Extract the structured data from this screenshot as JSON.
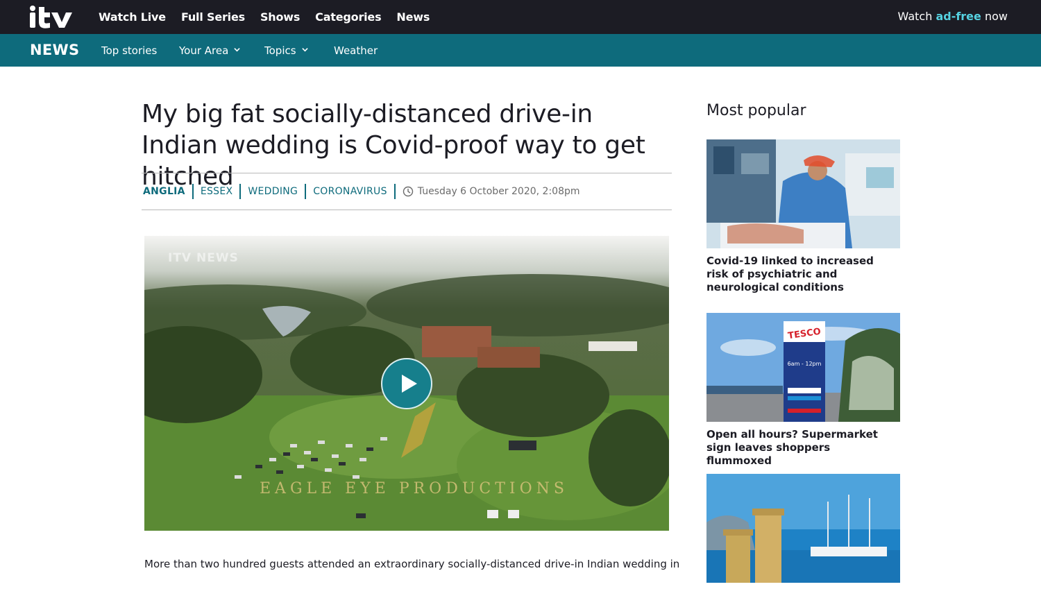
{
  "topbar": {
    "brand": "itv",
    "nav": [
      "Watch Live",
      "Full Series",
      "Shows",
      "Categories",
      "News"
    ],
    "watch_prefix": "Watch ",
    "watch_accent": "ad-free",
    "watch_suffix": " now"
  },
  "newsbar": {
    "brand": "NEWS",
    "top_stories": "Top stories",
    "your_area": "Your Area",
    "topics": "Topics",
    "weather": "Weather"
  },
  "article": {
    "headline": "My big fat socially-distanced drive-in Indian wedding is Covid-proof way to get hitched",
    "tags": [
      "ANGLIA",
      "ESSEX",
      "WEDDING",
      "CORONAVIRUS"
    ],
    "timestamp": "Tuesday 6 October 2020, 2:08pm",
    "video_watermark": "EAGLE EYE PRODUCTIONS",
    "video_channel_mark": "ITV NEWS",
    "body_first_line": "More than two hundred guests attended an extraordinary socially-distanced drive-in Indian wedding in"
  },
  "sidebar": {
    "title": "Most popular",
    "items": [
      {
        "caption": "Covid-19 linked to increased risk of psychiatric and neurological conditions"
      },
      {
        "caption": "Open all hours? Supermarket sign leaves shoppers flummoxed"
      },
      {
        "caption": ""
      }
    ],
    "tesco_sign": "TESCO",
    "tesco_hours": "6am - 12pm"
  },
  "colors": {
    "topbar": "#1c1c24",
    "newsbar": "#0e6b7c",
    "accent": "#55d1e0",
    "tag": "#0e6b7c",
    "play": "#167f8c"
  }
}
